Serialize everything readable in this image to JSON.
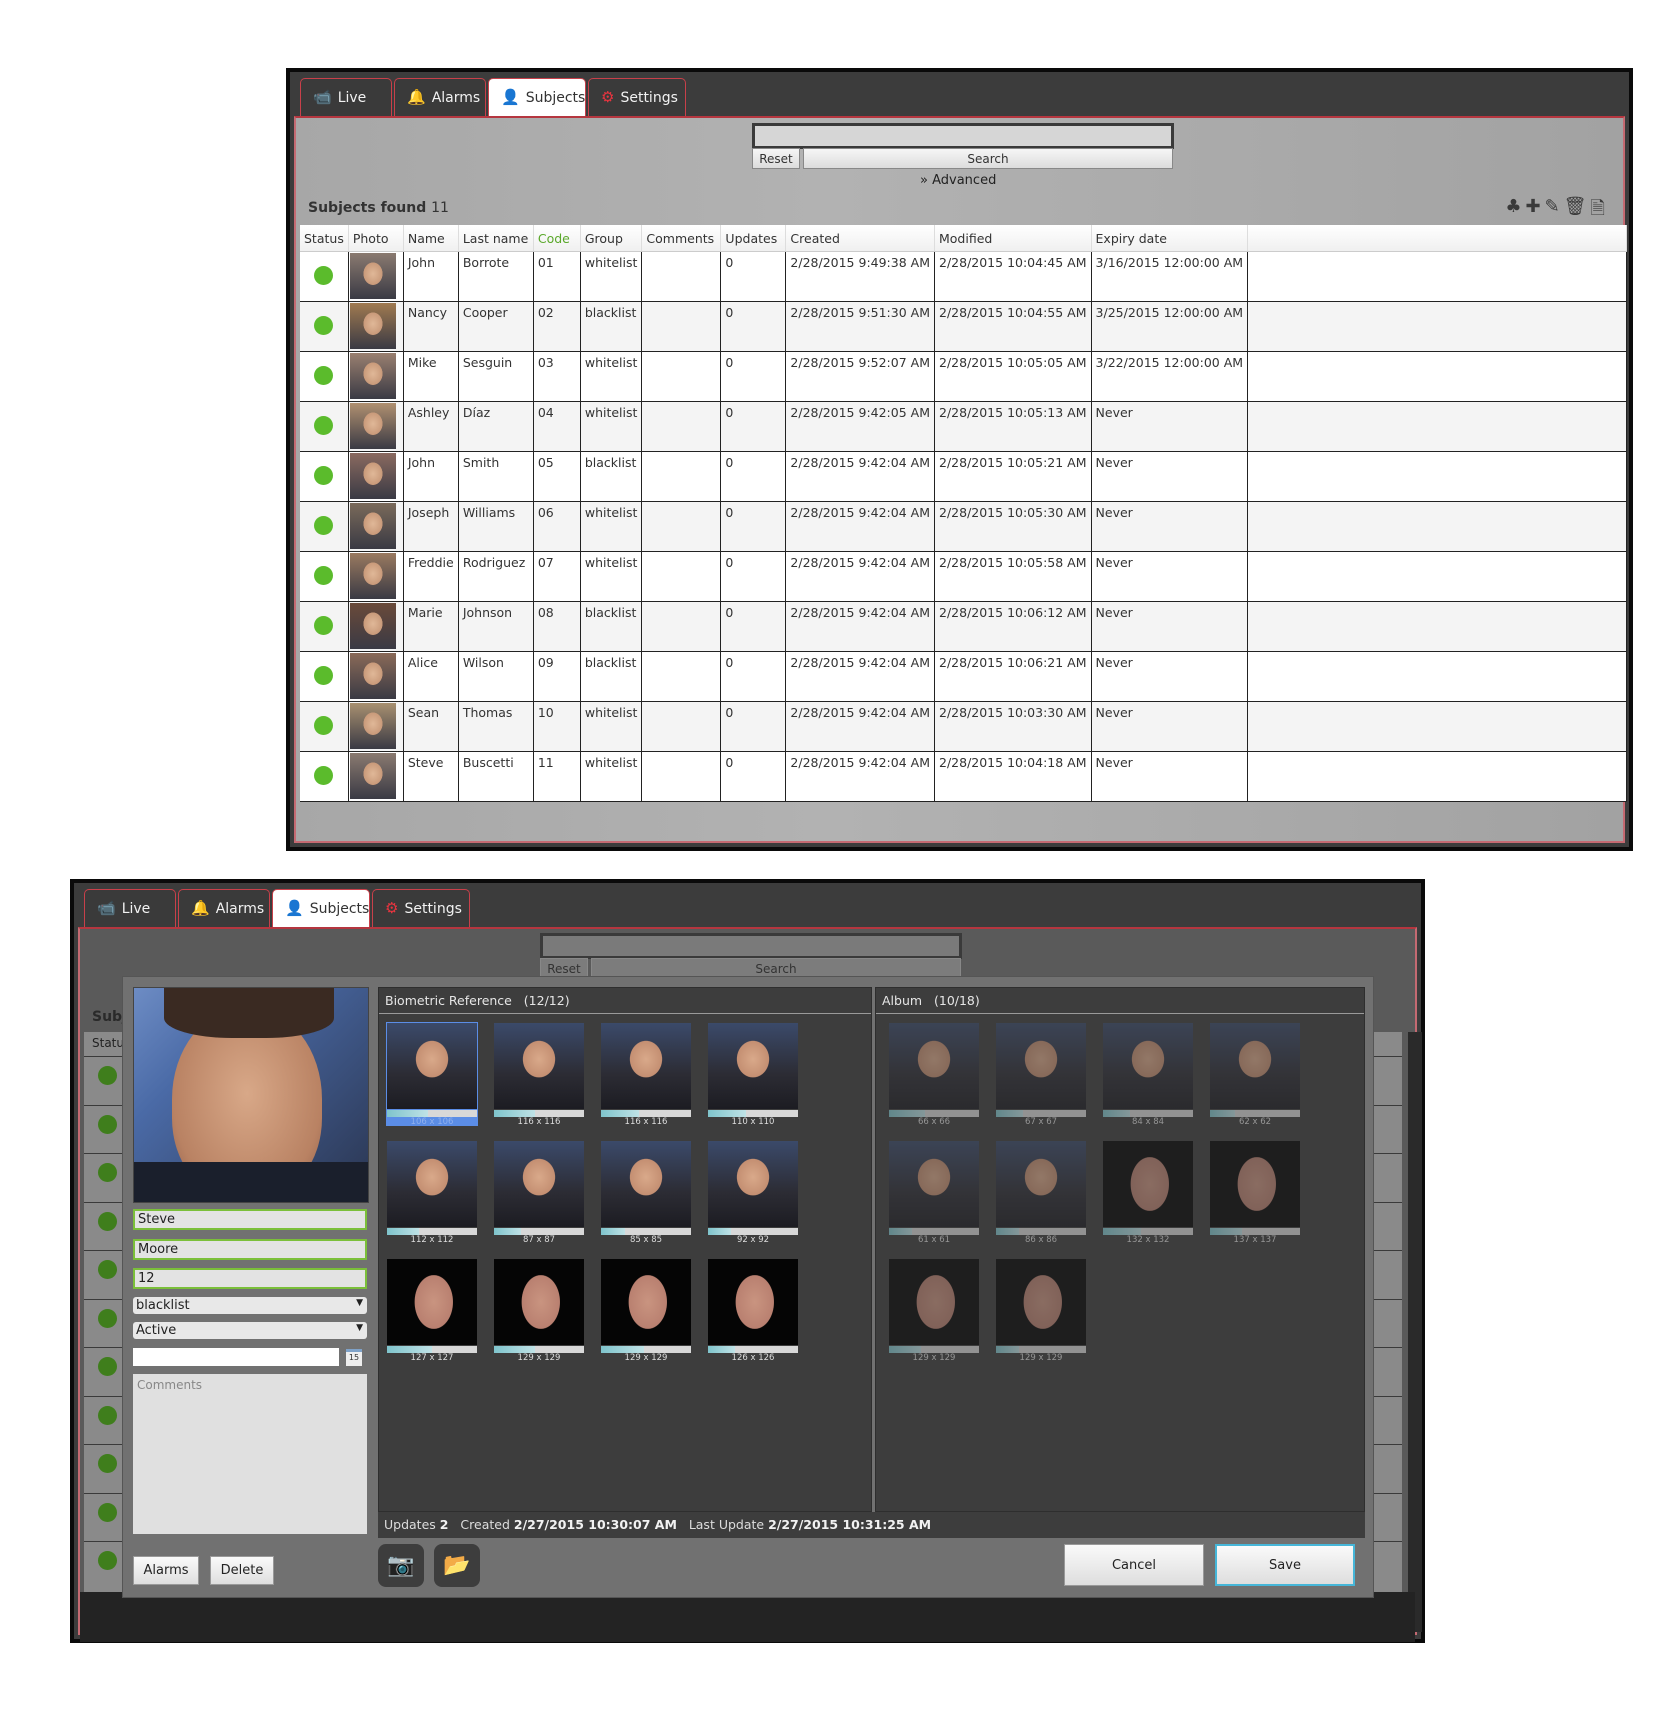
{
  "tabs": [
    {
      "label": "Live",
      "icon": "camera-icon"
    },
    {
      "label": "Alarms",
      "icon": "bell-icon"
    },
    {
      "label": "Subjects",
      "icon": "person-icon"
    },
    {
      "label": "Settings",
      "icon": "gear-icon"
    }
  ],
  "active_tab": "Subjects",
  "search": {
    "value": "",
    "reset_label": "Reset",
    "search_label": "Search",
    "advanced_label": "Advanced"
  },
  "subjects_found": {
    "label": "Subjects found",
    "count": "11"
  },
  "toolbar_icons": [
    "group-icon",
    "add-icon",
    "edit-icon",
    "delete-icon",
    "pdf-export-icon"
  ],
  "table": {
    "columns": [
      "Status",
      "Photo",
      "Name",
      "Last name",
      "Code",
      "Group",
      "Comments",
      "Updates",
      "Created",
      "Modified",
      "Expiry date"
    ],
    "rows": [
      {
        "status": "active",
        "name": "John",
        "last": "Borrote",
        "code": "01",
        "group": "whitelist",
        "comments": "",
        "updates": "0",
        "created": "2/28/2015 9:49:38 AM",
        "modified": "2/28/2015 10:04:45 AM",
        "expiry": "3/16/2015 12:00:00 AM"
      },
      {
        "status": "active",
        "name": "Nancy",
        "last": "Cooper",
        "code": "02",
        "group": "blacklist",
        "comments": "",
        "updates": "0",
        "created": "2/28/2015 9:51:30 AM",
        "modified": "2/28/2015 10:04:55 AM",
        "expiry": "3/25/2015 12:00:00 AM"
      },
      {
        "status": "active",
        "name": "Mike",
        "last": "Sesguin",
        "code": "03",
        "group": "whitelist",
        "comments": "",
        "updates": "0",
        "created": "2/28/2015 9:52:07 AM",
        "modified": "2/28/2015 10:05:05 AM",
        "expiry": "3/22/2015 12:00:00 AM"
      },
      {
        "status": "active",
        "name": "Ashley",
        "last": "Díaz",
        "code": "04",
        "group": "whitelist",
        "comments": "",
        "updates": "0",
        "created": "2/28/2015 9:42:05 AM",
        "modified": "2/28/2015 10:05:13 AM",
        "expiry": "Never"
      },
      {
        "status": "active",
        "name": "John",
        "last": "Smith",
        "code": "05",
        "group": "blacklist",
        "comments": "",
        "updates": "0",
        "created": "2/28/2015 9:42:04 AM",
        "modified": "2/28/2015 10:05:21 AM",
        "expiry": "Never"
      },
      {
        "status": "active",
        "name": "Joseph",
        "last": "Williams",
        "code": "06",
        "group": "whitelist",
        "comments": "",
        "updates": "0",
        "created": "2/28/2015 9:42:04 AM",
        "modified": "2/28/2015 10:05:30 AM",
        "expiry": "Never"
      },
      {
        "status": "active",
        "name": "Freddie",
        "last": "Rodriguez",
        "code": "07",
        "group": "whitelist",
        "comments": "",
        "updates": "0",
        "created": "2/28/2015 9:42:04 AM",
        "modified": "2/28/2015 10:05:58 AM",
        "expiry": "Never"
      },
      {
        "status": "active",
        "name": "Marie",
        "last": "Johnson",
        "code": "08",
        "group": "blacklist",
        "comments": "",
        "updates": "0",
        "created": "2/28/2015 9:42:04 AM",
        "modified": "2/28/2015 10:06:12 AM",
        "expiry": "Never"
      },
      {
        "status": "active",
        "name": "Alice",
        "last": "Wilson",
        "code": "09",
        "group": "blacklist",
        "comments": "",
        "updates": "0",
        "created": "2/28/2015 9:42:04 AM",
        "modified": "2/28/2015 10:06:21 AM",
        "expiry": "Never"
      },
      {
        "status": "active",
        "name": "Sean",
        "last": "Thomas",
        "code": "10",
        "group": "whitelist",
        "comments": "",
        "updates": "0",
        "created": "2/28/2015 9:42:04 AM",
        "modified": "2/28/2015 10:03:30 AM",
        "expiry": "Never"
      },
      {
        "status": "active",
        "name": "Steve",
        "last": "Buscetti",
        "code": "11",
        "group": "whitelist",
        "comments": "",
        "updates": "0",
        "created": "2/28/2015 9:42:04 AM",
        "modified": "2/28/2015 10:04:18 AM",
        "expiry": "Never"
      }
    ]
  },
  "colors": {
    "accent_red": "#e8343f",
    "status_green": "#5bbb2c",
    "code_header_green": "#5aa82a",
    "selection_blue": "#5b8de6"
  },
  "editor": {
    "underlay_labels": {
      "subjects": "Subj",
      "status": "Statu"
    },
    "first_name": "Steve",
    "last_name": "Moore",
    "code": "12",
    "group": "blacklist",
    "state": "Active",
    "expiry": "",
    "comments_placeholder": "Comments",
    "alarms_label": "Alarms",
    "delete_label": "Delete",
    "biometric": {
      "title": "Biometric Reference",
      "count": "(12/12)",
      "items": [
        {
          "size": "106 x 106",
          "quality": 0.45,
          "type": "photo",
          "selected": true
        },
        {
          "size": "116 x 116",
          "quality": 0.45,
          "type": "photo"
        },
        {
          "size": "116 x 116",
          "quality": 0.42,
          "type": "photo"
        },
        {
          "size": "110 x 110",
          "quality": 0.42,
          "type": "photo"
        },
        {
          "size": "112 x 112",
          "quality": 0.35,
          "type": "photo"
        },
        {
          "size": "87 x 87",
          "quality": 0.3,
          "type": "photo"
        },
        {
          "size": "85 x 85",
          "quality": 0.27,
          "type": "photo"
        },
        {
          "size": "92 x 92",
          "quality": 0.25,
          "type": "photo"
        },
        {
          "size": "127 x 127",
          "quality": 0.5,
          "type": "mask"
        },
        {
          "size": "129 x 129",
          "quality": 0.45,
          "type": "mask"
        },
        {
          "size": "129 x 129",
          "quality": 0.48,
          "type": "mask"
        },
        {
          "size": "126 x 126",
          "quality": 0.3,
          "type": "mask"
        }
      ]
    },
    "album": {
      "title": "Album",
      "count": "(10/18)",
      "items": [
        {
          "size": "66 x 66",
          "quality": 0.4,
          "type": "photo"
        },
        {
          "size": "67 x 67",
          "quality": 0.3,
          "type": "photo"
        },
        {
          "size": "84 x 84",
          "quality": 0.3,
          "type": "photo"
        },
        {
          "size": "62 x 62",
          "quality": 0.28,
          "type": "photo"
        },
        {
          "size": "61 x 61",
          "quality": 0.25,
          "type": "photo"
        },
        {
          "size": "86 x 86",
          "quality": 0.25,
          "type": "photo"
        },
        {
          "size": "132 x 132",
          "quality": 0.42,
          "type": "mask"
        },
        {
          "size": "137 x 137",
          "quality": 0.36,
          "type": "mask"
        },
        {
          "size": "129 x 129",
          "quality": 0.35,
          "type": "mask"
        },
        {
          "size": "129 x 129",
          "quality": 0.25,
          "type": "mask"
        }
      ]
    },
    "info": {
      "updates_label": "Updates",
      "updates": "2",
      "created_label": "Created",
      "created": "2/27/2015 10:30:07 AM",
      "last_update_label": "Last Update",
      "last_update": "2/27/2015 10:31:25 AM"
    },
    "camera_button_icon": "security-camera-icon",
    "folder_button_icon": "folder-icon",
    "cancel_label": "Cancel",
    "save_label": "Save"
  }
}
